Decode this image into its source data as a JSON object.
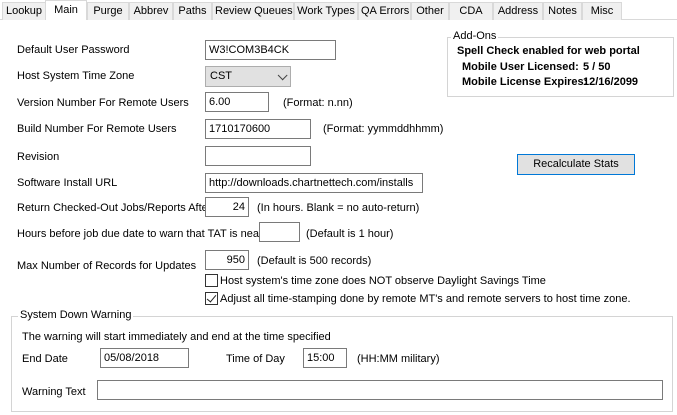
{
  "tabs": [
    {
      "label": "Lookup"
    },
    {
      "label": "Main"
    },
    {
      "label": "Purge"
    },
    {
      "label": "Abbrev"
    },
    {
      "label": "Paths"
    },
    {
      "label": "Review Queues"
    },
    {
      "label": "Work Types"
    },
    {
      "label": "QA Errors"
    },
    {
      "label": "Other"
    },
    {
      "label": "CDA"
    },
    {
      "label": "Address"
    },
    {
      "label": "Notes"
    },
    {
      "label": "Misc"
    }
  ],
  "active_tab": "Main",
  "form": {
    "default_password": {
      "label": "Default User Password",
      "value": "W3!COM3B4CK"
    },
    "time_zone": {
      "label": "Host System Time Zone",
      "value": "CST"
    },
    "version": {
      "label": "Version Number For Remote Users",
      "value": "6.00",
      "hint": "(Format:  n.nn)"
    },
    "build": {
      "label": "Build Number For Remote Users",
      "value": "1710170600",
      "hint": "(Format: yymmddhhmm)"
    },
    "revision": {
      "label": "Revision",
      "value": ""
    },
    "install_url": {
      "label": "Software Install URL",
      "value": "http://downloads.chartnettech.com/installs"
    },
    "return_after": {
      "label": "Return Checked-Out Jobs/Reports After",
      "value": "24",
      "hint": "(In hours.  Blank = no auto-return)"
    },
    "tat_warn": {
      "label": "Hours before job due date to warn that TAT is near",
      "value": "",
      "hint": "(Default is 1 hour)"
    },
    "max_records": {
      "label": "Max Number of Records for Updates",
      "value": "950",
      "hint": "(Default is 500 records)"
    },
    "no_dst": {
      "label": "Host system's time zone does NOT observe Daylight Savings Time",
      "checked": false
    },
    "adjust_ts": {
      "label": "Adjust all time-stamping done by remote MT's and remote servers to host time zone.",
      "checked": true
    }
  },
  "addons": {
    "title": "Add-Ons",
    "spell_check": "Spell Check enabled for web portal",
    "licensed_label": "Mobile User Licensed:",
    "licensed_value": "5 / 50",
    "expires_label": "Mobile License Expires:",
    "expires_value": "12/16/2099"
  },
  "recalc_button": "Recalculate Stats",
  "system_down": {
    "title": "System Down Warning",
    "description": "The warning will start immediately and  end at the time specified",
    "end_date_label": "End Date",
    "end_date_value": "05/08/2018",
    "time_label": "Time of Day",
    "time_value": "15:00",
    "time_hint": "(HH:MM military)",
    "warning_text_label": "Warning Text",
    "warning_text_value": ""
  },
  "colors": {
    "focus_border": "#0078d7",
    "tab_bg": "#f0f0f0",
    "button_bg": "#e1e1e1"
  }
}
